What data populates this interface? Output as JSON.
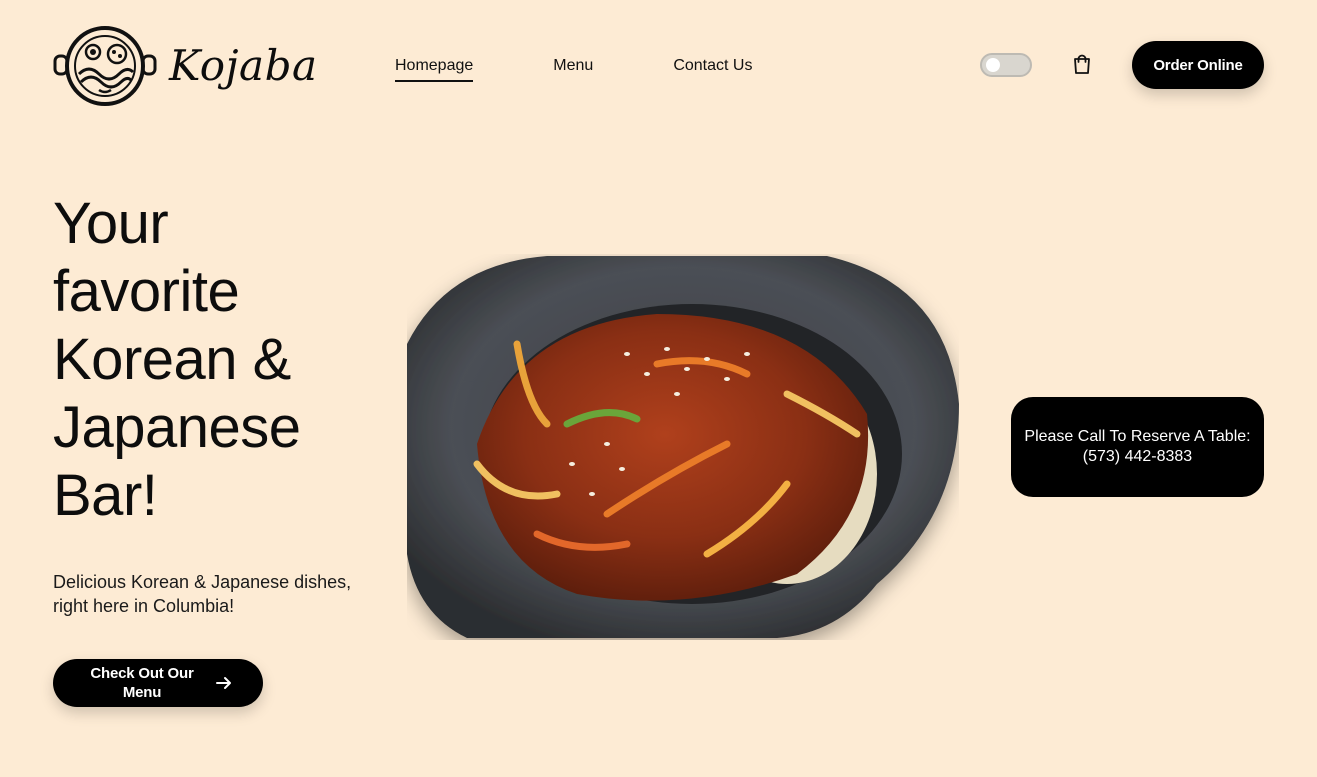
{
  "brand": {
    "name": "Kojaba"
  },
  "nav": {
    "items": [
      {
        "label": "Homepage",
        "active": true
      },
      {
        "label": "Menu",
        "active": false
      },
      {
        "label": "Contact Us",
        "active": false
      }
    ]
  },
  "header": {
    "theme_toggle_icon": "toggle-switch",
    "cart_icon": "shopping-bag-icon",
    "order_button": "Order Online"
  },
  "hero": {
    "headline_lines": [
      "Your",
      "favorite",
      "Korean &",
      "Japanese",
      "Bar!"
    ],
    "subtext": "Delicious Korean & Japanese dishes, right here in Columbia!",
    "cta_label": "Check Out Our Menu",
    "cta_icon": "arrow-right-icon"
  },
  "reserve": {
    "line1": "Please Call To Reserve A Table:",
    "phone": "(573) 442-8383"
  },
  "colors": {
    "background": "#fdebd4",
    "primary": "#000000",
    "text": "#0d0d0d"
  }
}
